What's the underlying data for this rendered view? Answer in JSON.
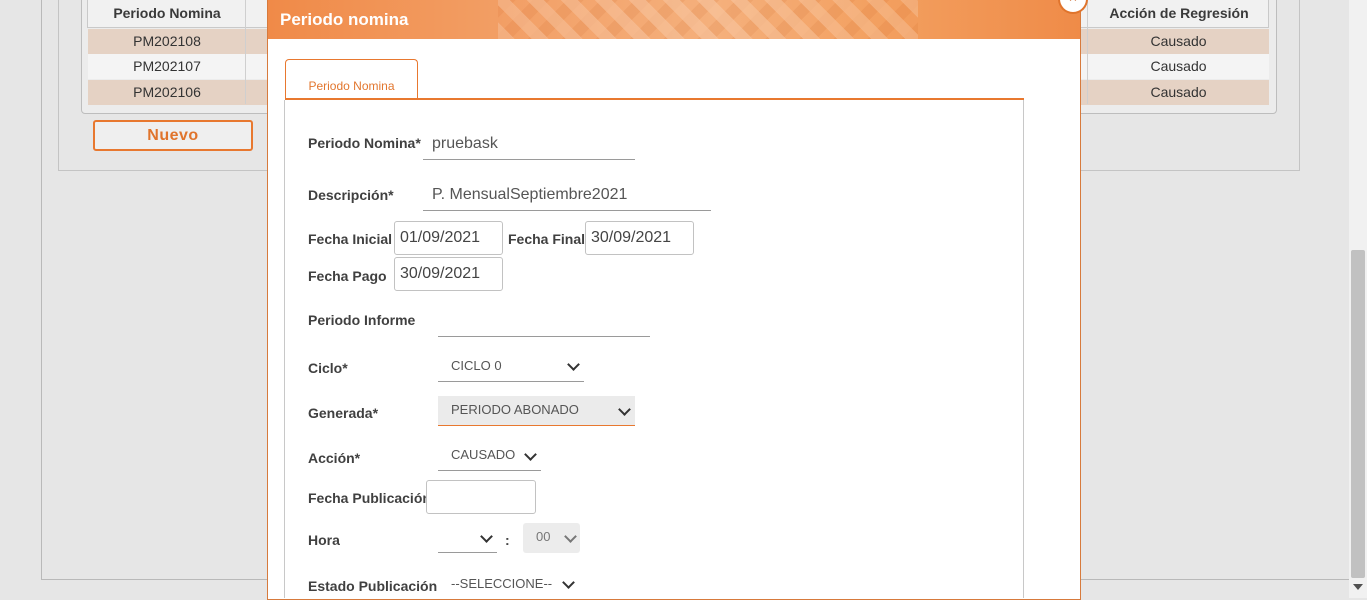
{
  "background_grid": {
    "columns": [
      "Periodo Nomina",
      "Acción de Regresión"
    ],
    "rows": [
      {
        "periodo": "PM202108",
        "accion": "Causado"
      },
      {
        "periodo": "PM202107",
        "accion": "Causado"
      },
      {
        "periodo": "PM202106",
        "accion": "Causado"
      }
    ],
    "new_button": "Nuevo"
  },
  "modal": {
    "title": "Periodo nomina",
    "close_symbol": "×",
    "tab_label": "Periodo Nomina",
    "fields": {
      "periodo_nomina": {
        "label": "Periodo Nomina*",
        "value": "pruebask"
      },
      "descripcion": {
        "label": "Descripción*",
        "value": "P. MensualSeptiembre2021"
      },
      "fecha_inicial": {
        "label": "Fecha Inicial *",
        "value": "01/09/2021"
      },
      "fecha_final": {
        "label": "Fecha Final*",
        "value": "30/09/2021"
      },
      "fecha_pago": {
        "label": "Fecha Pago",
        "value": "30/09/2021"
      },
      "periodo_informe": {
        "label": "Periodo Informe",
        "value": ""
      },
      "ciclo": {
        "label": "Ciclo*",
        "value": "CICLO 0"
      },
      "generada": {
        "label": "Generada*",
        "value": "PERIODO ABONADO"
      },
      "accion": {
        "label": "Acción*",
        "value": "CAUSADO"
      },
      "fecha_publicacion": {
        "label": "Fecha Publicación",
        "value": ""
      },
      "hora": {
        "label": "Hora",
        "hour_value": "",
        "separator": ":",
        "minute_value": "00"
      },
      "estado_publicacion": {
        "label": "Estado Publicación",
        "value": "--SELECCIONE--"
      }
    }
  },
  "colors": {
    "accent": "#e8782f",
    "row_highlight": "#e5d2c4"
  }
}
